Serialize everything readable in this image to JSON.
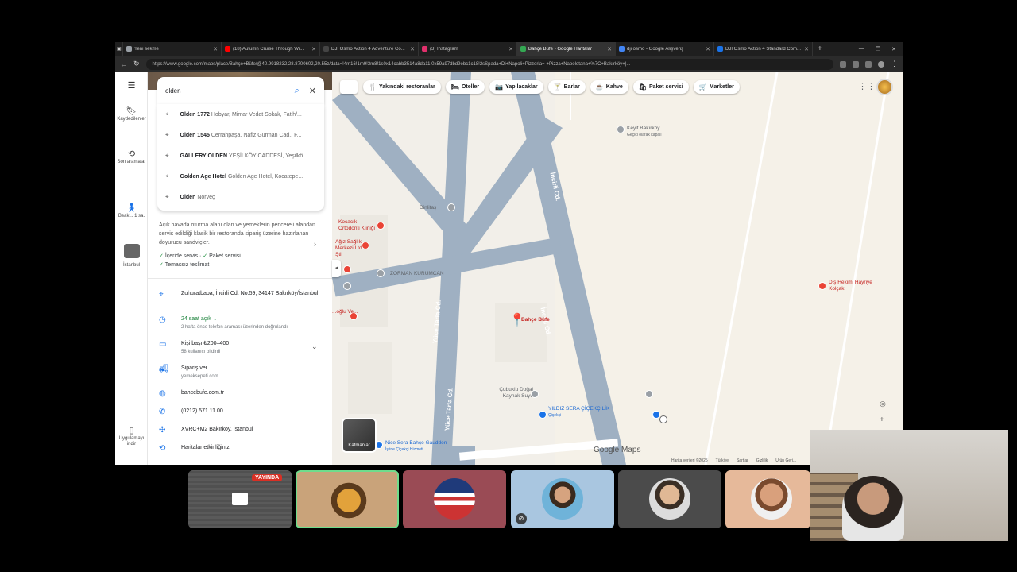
{
  "browser": {
    "tabs": [
      {
        "label": "Yeni sekme",
        "color": "#9aa0a6",
        "active": false
      },
      {
        "label": "(18) Autumn Cruise Through Wi...",
        "color": "#ff0000",
        "active": false
      },
      {
        "label": "DJI Osmo Action 4 Adventure Co...",
        "color": "#444444",
        "active": false
      },
      {
        "label": "(3) Instagram",
        "color": "#e1306c",
        "active": false
      },
      {
        "label": "Bahçe Büfe - Google Haritalar",
        "color": "#34a853",
        "active": true
      },
      {
        "label": "dji osmo - Google Alışveriş",
        "color": "#4285f4",
        "active": false
      },
      {
        "label": "DJI Osmo Action 4 Standard Com...",
        "color": "#1a73e8",
        "active": false
      }
    ],
    "url": "https://www.google.com/maps/place/Bahçe+Büfe/@40.9918232,28.8700602,20.55z/data=!4m16!1m9!3m8!1s0x14cabb3514a8da11:0x59a97dbd9ebc1c18!2sSpada+Di+Napoli+Pizzeria+-+Pizza+Napoletana+%7C+Bakırköy+|..."
  },
  "rail": {
    "saved": "Kaydedilenler",
    "recent": "Son aramalar",
    "place1": "Beak... 1 sa.",
    "place2": "İstanbul",
    "apps": "Uygulamayı indir"
  },
  "search": {
    "value": "olden",
    "suggestions": [
      {
        "bold": "Olden 1772",
        "rest": "Hobyar, Mimar Vedat Sokak, Fatih/..."
      },
      {
        "bold": "Olden 1545",
        "rest": "Cerrahpaşa, Nafiz Gürman Cad., F..."
      },
      {
        "bold": "GALLERY OLDEN",
        "rest": "YEŞİLKÖY CADDESİ, Yeşilkö..."
      },
      {
        "bold": "Golden Age Hotel",
        "rest": "Golden Age Hotel, Kocatepe..."
      },
      {
        "bold": "Olden",
        "rest": "Norveç"
      }
    ]
  },
  "place": {
    "description": "Açık havada oturma alanı olan ve yemeklerin pencereli alandan servis edildiği klasik bir restoranda sipariş üzerine hazırlanan doyurucu sandviçler.",
    "features": [
      "İçeride servis ·",
      "Paket servisi",
      "Temassız teslimat"
    ],
    "address": "Zuhuratbaba, İncirli Cd. No:59, 34147 Bakırköy/İstanbul",
    "hours": "24 saat açık",
    "hours_note": "2 hafta önce telefon araması üzerinden doğrulandı",
    "price": "Kişi başı ₺200–400",
    "price_note": "58 kullanıcı bildirdi",
    "order": "Sipariş ver",
    "order_site": "yemeksepeti.com",
    "website": "bahcebufe.com.tr",
    "phone": "(0212) 571 11 00",
    "pluscode": "XVRC+M2 Bakırköy, İstanbul",
    "activity": "Haritalar etkinliğiniz"
  },
  "chips": [
    {
      "icon": "🍴",
      "label": "Yakındaki restoranlar"
    },
    {
      "icon": "🛏",
      "label": "Oteller"
    },
    {
      "icon": "📷",
      "label": "Yapılacaklar"
    },
    {
      "icon": "🍸",
      "label": "Barlar"
    },
    {
      "icon": "☕",
      "label": "Kahve"
    },
    {
      "icon": "🛍",
      "label": "Paket servisi"
    },
    {
      "icon": "🛒",
      "label": "Marketler"
    }
  ],
  "map": {
    "streets": [
      "Yüce Tarla Cd.",
      "İncirli Cd.",
      "Yüce Tarla Cd.",
      "İncirli Cd."
    ],
    "pois": {
      "keyif": "Keyif Bakırköy",
      "keyif_sub": "Geçici olarak kapalı",
      "dinlitas": "Dinlitaş",
      "kocacik": "Kocacık Ortodonti Kliniği",
      "agiz": "Ağız Sağlık Merkezi Ltd. Şti",
      "zorman": "ZORMAN KURUMCAN",
      "bahce": "Bahçe Büfe",
      "doglu": "...oğlu Ve...",
      "cubuklu": "Çubuklu Doğal Kaynak Suyu",
      "yildiz": "YILDIZ SERA ÇİÇEKÇİLİK",
      "yildiz_sub": "Çiçekçi",
      "dis": "Diş Hekimi Hayriye Kolçak",
      "nice": "Nice Sera Bahçe Gaudden",
      "nice_sub": "İştine Çiçekçi Hizmeti"
    },
    "layers": "Katmanlar",
    "google": "Google Maps",
    "footer": [
      "Harita verileri ©2025",
      "Türkiye",
      "Şartlar",
      "Gizlilik",
      "Ürün Geri..."
    ]
  },
  "meet": {
    "live": "YAYINDA"
  }
}
